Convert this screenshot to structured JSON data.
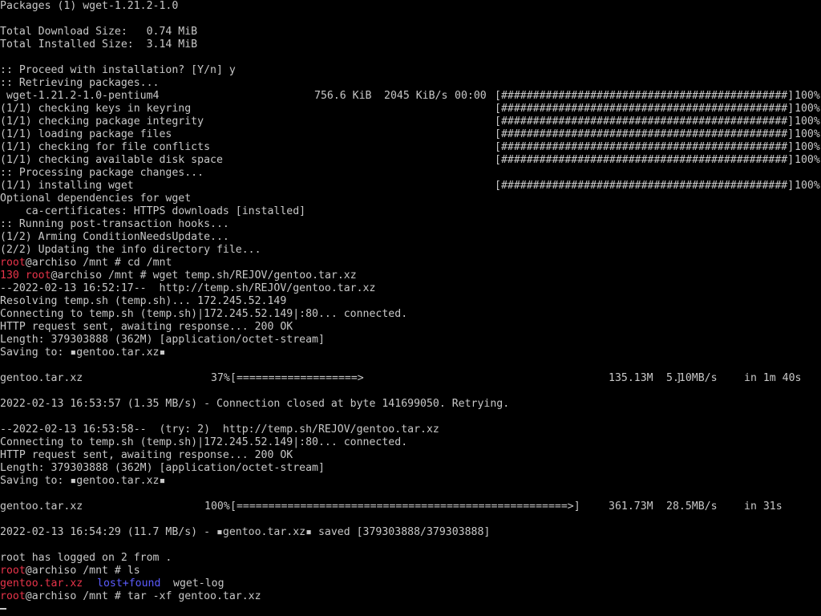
{
  "colors": {
    "background": "#000000",
    "text": "#c8c8c8",
    "prompt_user": "#e8344a",
    "exit_code": "#e8344a",
    "file_archive": "#e8344a",
    "directory": "#5c5cff"
  },
  "terminal": {
    "pacman": {
      "packages_line": "Packages (1) wget-1.21.2-1.0",
      "download_size": "Total Download Size:   0.74 MiB",
      "installed_size": "Total Installed Size:  3.14 MiB",
      "proceed": ":: Proceed with installation? [Y/n] y",
      "retrieving": ":: Retrieving packages...",
      "retrieve_row": {
        "name": " wget-1.21.2-1.0-pentium4",
        "size": "756.6 KiB",
        "speed": "2045 KiB/s",
        "time": "00:00",
        "bar": "[#############################################]",
        "percent": "100%"
      },
      "steps": [
        {
          "label": "(1/1) checking keys in keyring",
          "bar": "[#############################################]",
          "percent": "100%"
        },
        {
          "label": "(1/1) checking package integrity",
          "bar": "[#############################################]",
          "percent": "100%"
        },
        {
          "label": "(1/1) loading package files",
          "bar": "[#############################################]",
          "percent": "100%"
        },
        {
          "label": "(1/1) checking for file conflicts",
          "bar": "[#############################################]",
          "percent": "100%"
        },
        {
          "label": "(1/1) checking available disk space",
          "bar": "[#############################################]",
          "percent": "100%"
        }
      ],
      "processing": ":: Processing package changes...",
      "installing": {
        "label": "(1/1) installing wget",
        "bar": "[#############################################]",
        "percent": "100%"
      },
      "optional_header": "Optional dependencies for wget",
      "optional_item": "    ca-certificates: HTTPS downloads [installed]",
      "hooks": ":: Running post-transaction hooks...",
      "hook1": "(1/2) Arming ConditionNeedsUpdate...",
      "hook2": "(2/2) Updating the info directory file..."
    },
    "prompt": {
      "user": "root",
      "host_path": "@archiso /mnt # ",
      "host_path_short": "@archiso ",
      "path": "/mnt",
      "hash": " # "
    },
    "cmd_cd": "cd /mnt",
    "exit_code": "130 ",
    "cmd_wget": "wget temp.sh/REJOV/gentoo.tar.xz",
    "wget1": {
      "start": "--2022-02-13 16:52:17--  http://temp.sh/REJOV/gentoo.tar.xz",
      "resolving": "Resolving temp.sh (temp.sh)... 172.245.52.149",
      "connecting": "Connecting to temp.sh (temp.sh)|172.245.52.149|:80... connected.",
      "request": "HTTP request sent, awaiting response... 200 OK",
      "length": "Length: 379303888 (362M) [application/octet-stream]",
      "saving": "Saving to: ▪gentoo.tar.xz▪",
      "progress": {
        "file": "gentoo.tar.xz",
        "percent": "37%",
        "bar": "[===================>                                                 ]",
        "size": "135.13M",
        "speed": "5.10MB/s",
        "eta": "in 1m 40s"
      },
      "closed": "2022-02-13 16:53:57 (1.35 MB/s) - Connection closed at byte 141699050. Retrying."
    },
    "wget2": {
      "start": "--2022-02-13 16:53:58--  (try: 2)  http://temp.sh/REJOV/gentoo.tar.xz",
      "connecting": "Connecting to temp.sh (temp.sh)|172.245.52.149|:80... connected.",
      "request": "HTTP request sent, awaiting response... 200 OK",
      "length": "Length: 379303888 (362M) [application/octet-stream]",
      "saving": "Saving to: ▪gentoo.tar.xz▪",
      "progress": {
        "file": "gentoo.tar.xz",
        "percent": "100%",
        "bar": "[====================================================>]",
        "size": "361.73M",
        "speed": "28.5MB/s",
        "eta": "in 31s"
      },
      "saved": "2022-02-13 16:54:29 (11.7 MB/s) - ▪gentoo.tar.xz▪ saved [379303888/379303888]"
    },
    "login_notice": "root has logged on 2 from .",
    "cmd_ls": "ls",
    "ls_output": {
      "archive": "gentoo.tar.xz",
      "directory": "lost+found",
      "file": "wget-log"
    },
    "cmd_tar": "tar -xf gentoo.tar.xz"
  }
}
